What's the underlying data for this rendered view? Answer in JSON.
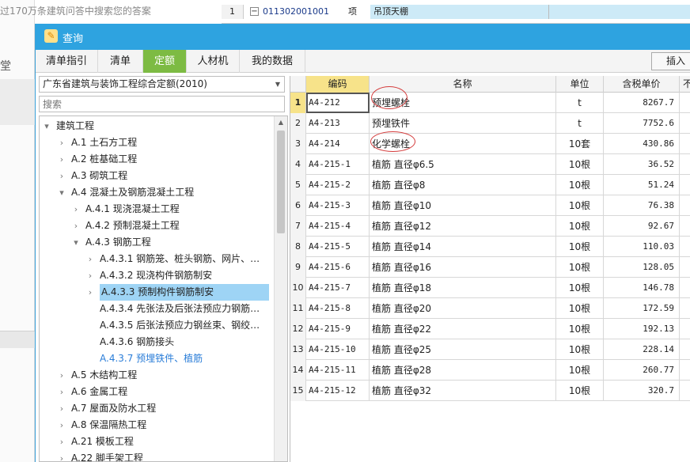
{
  "background": {
    "hint": "过170万条建筑问答中搜索您的答案",
    "side_text": "堂",
    "row": {
      "num": "1",
      "toggle": "−",
      "code": "011302001001",
      "unit": "项",
      "name": "吊顶天棚"
    }
  },
  "dialog": {
    "title": "查询",
    "tabs": [
      {
        "label": "清单指引"
      },
      {
        "label": "清单"
      },
      {
        "label": "定额"
      },
      {
        "label": "人材机"
      },
      {
        "label": "我的数据"
      }
    ],
    "insert_label": "插入"
  },
  "left": {
    "selected_library": "广东省建筑与装饰工程综合定额(2010)",
    "search_placeholder": "搜索",
    "tree": [
      {
        "arrow": "▾",
        "label": "建筑工程"
      },
      {
        "arrow": "›",
        "label": "A.1 土石方工程"
      },
      {
        "arrow": "›",
        "label": "A.2 桩基础工程"
      },
      {
        "arrow": "›",
        "label": "A.3 砌筑工程"
      },
      {
        "arrow": "▾",
        "label": "A.4 混凝土及钢筋混凝土工程"
      },
      {
        "arrow": "›",
        "label": "A.4.1 现浇混凝土工程"
      },
      {
        "arrow": "›",
        "label": "A.4.2 预制混凝土工程"
      },
      {
        "arrow": "▾",
        "label": "A.4.3 钢筋工程"
      },
      {
        "arrow": "›",
        "label": "A.4.3.1 钢筋笼、桩头钢筋、网片、…"
      },
      {
        "arrow": "›",
        "label": "A.4.3.2 现浇构件钢筋制安"
      },
      {
        "arrow": "›",
        "label": "A.4.3.3 预制构件钢筋制安"
      },
      {
        "arrow": "",
        "label": "A.4.3.4 先张法及后张法预应力钢筋…"
      },
      {
        "arrow": "",
        "label": "A.4.3.5 后张法预应力钢丝束、钢绞…"
      },
      {
        "arrow": "",
        "label": "A.4.3.6 钢筋接头"
      },
      {
        "arrow": "",
        "label": "A.4.3.7 预埋铁件、植筋"
      },
      {
        "arrow": "›",
        "label": "A.5 木结构工程"
      },
      {
        "arrow": "›",
        "label": "A.6 金属工程"
      },
      {
        "arrow": "›",
        "label": "A.7 屋面及防水工程"
      },
      {
        "arrow": "›",
        "label": "A.8 保温隔热工程"
      },
      {
        "arrow": "›",
        "label": "A.21 模板工程"
      },
      {
        "arrow": "›",
        "label": "A.22 脚手架工程"
      }
    ]
  },
  "grid": {
    "headers": {
      "code": "编码",
      "name": "名称",
      "unit": "单位",
      "price": "含税单价",
      "extra": "不"
    },
    "rows": [
      {
        "num": "1",
        "code": "A4-212",
        "name": "预埋螺栓",
        "unit": "t",
        "price": "8267.7"
      },
      {
        "num": "2",
        "code": "A4-213",
        "name": "预埋铁件",
        "unit": "t",
        "price": "7752.6"
      },
      {
        "num": "3",
        "code": "A4-214",
        "name": "化学螺栓",
        "unit": "10套",
        "price": "430.86"
      },
      {
        "num": "4",
        "code": "A4-215-1",
        "name": "植筋 直径φ6.5",
        "unit": "10根",
        "price": "36.52"
      },
      {
        "num": "5",
        "code": "A4-215-2",
        "name": "植筋 直径φ8",
        "unit": "10根",
        "price": "51.24"
      },
      {
        "num": "6",
        "code": "A4-215-3",
        "name": "植筋 直径φ10",
        "unit": "10根",
        "price": "76.38"
      },
      {
        "num": "7",
        "code": "A4-215-4",
        "name": "植筋 直径φ12",
        "unit": "10根",
        "price": "92.67"
      },
      {
        "num": "8",
        "code": "A4-215-5",
        "name": "植筋 直径φ14",
        "unit": "10根",
        "price": "110.03"
      },
      {
        "num": "9",
        "code": "A4-215-6",
        "name": "植筋 直径φ16",
        "unit": "10根",
        "price": "128.05"
      },
      {
        "num": "10",
        "code": "A4-215-7",
        "name": "植筋 直径φ18",
        "unit": "10根",
        "price": "146.78"
      },
      {
        "num": "11",
        "code": "A4-215-8",
        "name": "植筋 直径φ20",
        "unit": "10根",
        "price": "172.59"
      },
      {
        "num": "12",
        "code": "A4-215-9",
        "name": "植筋 直径φ22",
        "unit": "10根",
        "price": "192.13"
      },
      {
        "num": "13",
        "code": "A4-215-10",
        "name": "植筋 直径φ25",
        "unit": "10根",
        "price": "228.14"
      },
      {
        "num": "14",
        "code": "A4-215-11",
        "name": "植筋 直径φ28",
        "unit": "10根",
        "price": "260.77"
      },
      {
        "num": "15",
        "code": "A4-215-12",
        "name": "植筋 直径φ32",
        "unit": "10根",
        "price": "320.7"
      }
    ]
  },
  "colors": {
    "titlebar": "#2ea3e0",
    "active_tab": "#7dbb43",
    "selected_node": "#9ed4f5",
    "annotation": "#d43b3b"
  }
}
